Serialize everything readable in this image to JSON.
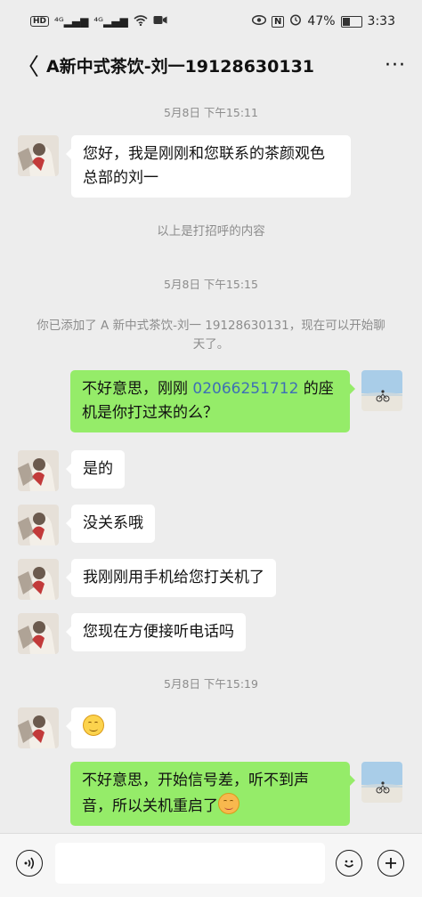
{
  "status_bar": {
    "left_icons": [
      "hd-icon",
      "signal-4g-icon",
      "signal-4g-icon",
      "wifi-icon",
      "video-icon"
    ],
    "battery": "47%",
    "alarm_nfc": [
      "eye-icon",
      "nfc-icon",
      "alarm-icon"
    ],
    "battery_level": 0.47,
    "time": "3:33"
  },
  "header": {
    "back": "〈",
    "title": "A新中式茶饮-刘一19128630131",
    "more": "···"
  },
  "messages": {
    "t1": "5月8日 下午15:11",
    "m1": "您好，我是刚刚和您联系的茶颜观色总部的刘一",
    "sys1": "以上是打招呼的内容",
    "t2": "5月8日 下午15:15",
    "sys2": "你已添加了 A 新中式茶饮-刘一 19128630131，现在可以开始聊天了。",
    "m2_pre": "不好意思，刚刚 ",
    "m2_phone": "02066251712",
    "m2_post": " 的座机是你打过来的么？",
    "m3": "是的",
    "m4": "没关系哦",
    "m5": "我刚刚用手机给您打关机了",
    "m6": "您现在方便接听电话吗",
    "t3": "5月8日 下午15:19",
    "m8": "不好意思，开始信号差，听不到声音，所以关机重启了"
  },
  "input_bar": {
    "voice_icon": "voice-icon",
    "input_value": "",
    "emoji_icon": "emoji-icon",
    "plus_icon": "plus-icon"
  },
  "colors": {
    "background": "#ededed",
    "bubble_self": "#95ec69",
    "bubble_other": "#ffffff",
    "phone_link": "#3d6fb5",
    "time_text": "#8c8c8c"
  }
}
